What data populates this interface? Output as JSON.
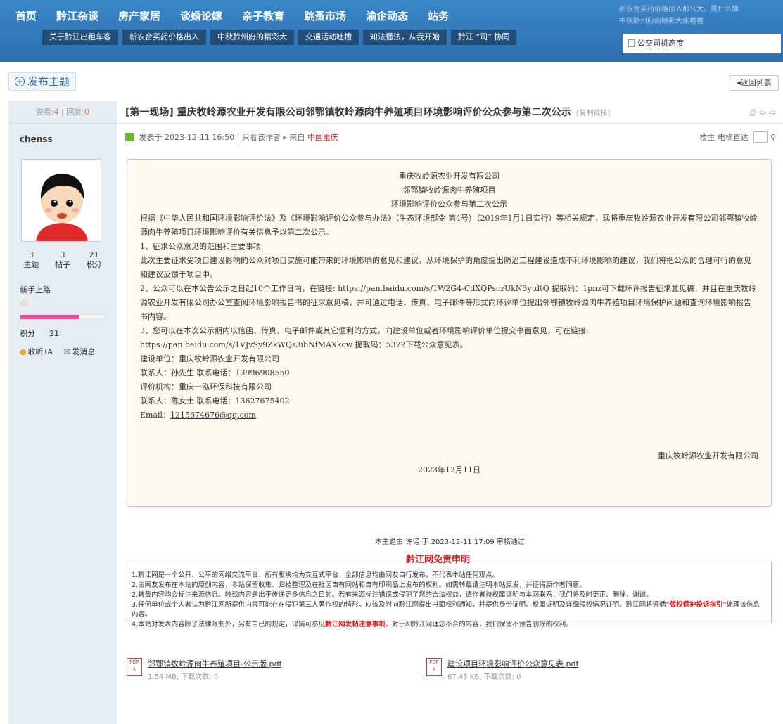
{
  "nav": [
    "首页",
    "黔江杂谈",
    "房产家居",
    "谈婚论嫁",
    "亲子教育",
    "跳蚤市场",
    "渝企动态",
    "站务"
  ],
  "news_strip": [
    "关于黔江出租车客",
    "新农合买药价格出入",
    "中秋黔州府的精彩大",
    "交通活动吐槽",
    "知法懂法，从我开始",
    "黔江 “司” 协同"
  ],
  "top_right": [
    "新农合买药价格出入那么大，是什么情",
    "中秋黔州府的精彩大家看看"
  ],
  "doc_card": "公交司机态度",
  "post_button": "发布主题",
  "back_button": "返回列表",
  "stats": {
    "view_label": "查看:",
    "views": "4",
    "reply_label": "回复:",
    "replies": "0"
  },
  "user": {
    "name": "chenss",
    "topics": "3",
    "topics_label": "主题",
    "posts": "3",
    "posts_label": "帖子",
    "credits": "21",
    "credits_label": "积分",
    "rank": "新手上路",
    "credit_label": "积分",
    "credit_value": "21",
    "follow": "收听TA",
    "message": "发消息",
    "progress": 0.7
  },
  "thread": {
    "title": "[第一现场] 重庆牧岭源农业开发有限公司邻鄂镇牧岭源肉牛养殖项目环境影响评价公众参与第二次公示",
    "copy_link": "[复制链接]",
    "posted": "发表于 2023-12-11 16:50",
    "only_author": "只看该作者",
    "from_label": "来自",
    "from": "中国重庆",
    "floor": "楼主",
    "jump": "电梯直达"
  },
  "content": {
    "heading1": "重庆牧岭源农业开发有限公司",
    "heading2": "邻鄂镇牧岭源肉牛养殖项目",
    "heading3": "环境影响评价公众参与第二次公示",
    "p1": "根据《中华人民共和国环境影响评价法》及《环境影响评价公众参与办法》（生态环境部令 第4号）（2019年1月1日实行）等相关规定，现将重庆牧岭源农业开发有限公司邻鄂镇牧岭源肉牛养殖项目环境影响评价有关信息予以第二次公示。",
    "p2": "1、征求公众意见的范围和主要事项",
    "p3": "此次主要征求受项目建设影响的公众对项目实施可能带来的环境影响的意见和建议，从环境保护的角度提出防治工程建设造成不利环境影响的建议，我们将把公众的合理可行的意见和建议反馈于项目中。",
    "p4": "2、公众可以在本公告公示之日起10个工作日内，在链接: https://pan.baidu.com/s/1W2G4-CdXQPsczUkN3ytdtQ 提取码：1pnz可下载环评报告征求意见稿，并且在重庆牧岭源农业开发有限公司办公室查阅环境影响报告书的征求意见稿，并可通过电话、传真、电子邮件等形式向环评单位提出邻鄂镇牧岭源肉牛养殖项目环境保护问题和查询环境影响报告书内容。",
    "p5": "3、您可以在本次公示期内以信函、传真、电子邮件或其它便利的方式，向建设单位或者环境影响评价单位提交书面意见，可在链接: https://pan.baidu.com/s/1VJvSy9ZkWQs3ibNfMAXkcw 提取码：5372下载公众意见表。",
    "p6": "建设单位：重庆牧岭源农业开发有限公司",
    "p7": "联系人：孙先生        联系电话：13996908550",
    "p8": "评价机构：重庆一泓环保科技有限公司",
    "p9": "联系人：陈女士        联系电话：13627675402",
    "email_label": "Email：",
    "email": "1215674676@qq.com",
    "signature": "重庆牧岭源农业开发有限公司",
    "date": "2023年12月11日"
  },
  "audit": "本主题由 许诺 于 2023-12-11 17:09 审核通过",
  "disclaimer": {
    "title": "黔江网免责申明",
    "l1": "1.黔江网是一个公开、公平的网络交流平台，所有版块均为交互式平台，全部信息均由网友自行发布，不代表本站任何观点。",
    "l2": "2.由网友发布在本站的原创内容，本站保留收集、归档整理及在社区自有网站和自有印刷品上发布的权利。如需转载请注明本站原发，并征得原作者同意。",
    "l3": "2.转载内容均会标注来源信息。转载内容是出于传递更多信息之目的。若有来源标注错误或侵犯了您的合法权益，请作者持权属证明与本网联系，我们将及时更正、删除，谢谢。",
    "l4a": "3.任何单位或个人者认为黔江网所提供内容可能存在侵犯第三人著作权的情形，应该及时向黔江网提出书面权利通知，并提供身份证明、权属证明及详细侵权情况证明。黔江网将遵循",
    "l4link": "\"版权保护投诉指引\"",
    "l4b": "处理该信息内容。",
    "l5a": "4.本站对发表内容除了法律限制外，另有自已的规定，详情可参见",
    "l5link": "黔江网发帖注意事项",
    "l5b": "。对于和黔江网理念不合的内容，我们保留不预告删除的权利。"
  },
  "attachments": [
    {
      "name": "邻鄂镇牧岭源肉牛养殖项目-公示版.pdf",
      "size": "1.54 MB, 下载次数: 0"
    },
    {
      "name": "建设项目环境影响评价公众意见表.pdf",
      "size": "67.43 KB, 下载次数: 0"
    }
  ]
}
